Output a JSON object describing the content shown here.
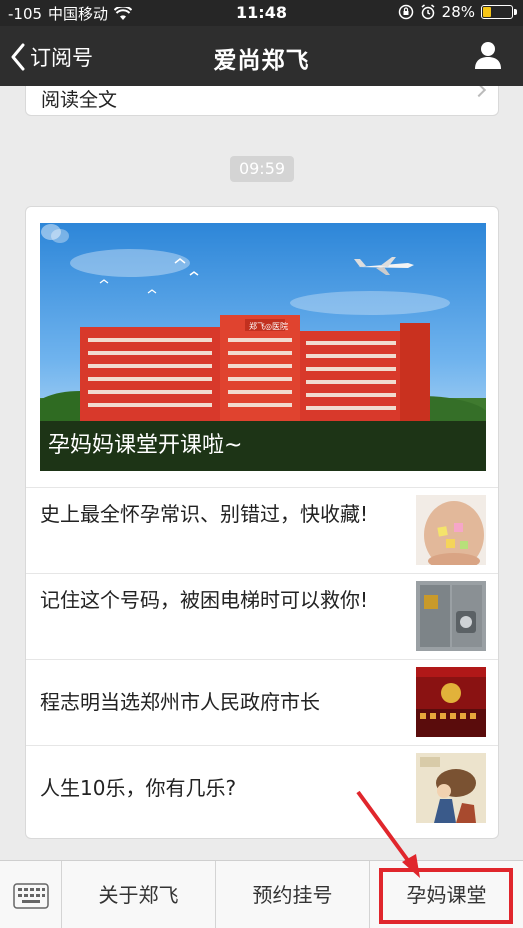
{
  "status_bar": {
    "signal": "-105",
    "carrier": "中国移动",
    "time": "11:48",
    "battery": "28%"
  },
  "nav": {
    "back_label": "订阅号",
    "title": "爱尚郑飞"
  },
  "previous_card": {
    "read_more": "阅读全文"
  },
  "message_time": "09:59",
  "article": {
    "hero_title": "孕妈妈课堂开课啦~",
    "hero_building_sign": "郑飞◎医院",
    "items": [
      {
        "title": "史上最全怀孕常识、别错过，快收藏!"
      },
      {
        "title": "记住这个号码，被困电梯时可以救你!"
      },
      {
        "title": "程志明当选郑州市人民政府市长"
      },
      {
        "title": "人生10乐，你有几乐?"
      }
    ]
  },
  "bottom_menu": {
    "items": [
      {
        "label": "关于郑飞"
      },
      {
        "label": "预约挂号"
      },
      {
        "label": "孕妈课堂"
      }
    ]
  },
  "colors": {
    "navbar": "#2e2e2e",
    "statusbar": "#262626",
    "background": "#ebebeb",
    "highlight": "#e0262c"
  }
}
